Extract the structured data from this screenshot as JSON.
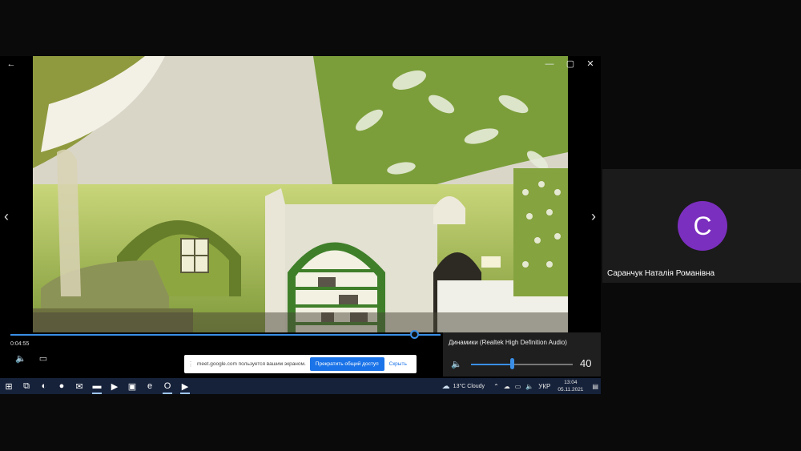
{
  "video": {
    "elapsed": "0:04:55"
  },
  "window_controls": {
    "back": "←",
    "minimize": "—",
    "maximize": "▢",
    "close": "✕"
  },
  "nav": {
    "prev": "‹",
    "next": "›"
  },
  "share_banner": {
    "message": "meet.google.com пользуется вашим экраном.",
    "stop_label": "Прекратить общий доступ",
    "hide_label": "Скрыть"
  },
  "volume": {
    "device": "Динамики (Realtek High Definition Audio)",
    "level": 40,
    "level_fraction": 0.4
  },
  "taskbar": {
    "apps": [
      {
        "icon": "windows-start-icon",
        "glyph": "⊞"
      },
      {
        "icon": "task-view-icon",
        "glyph": "⧉"
      },
      {
        "icon": "edge-icon",
        "glyph": "◐"
      },
      {
        "icon": "firefox-icon",
        "glyph": "●"
      },
      {
        "icon": "mail-icon",
        "glyph": "✉"
      },
      {
        "icon": "file-explorer-icon",
        "glyph": "▬"
      },
      {
        "icon": "media-player-icon",
        "glyph": "▶"
      },
      {
        "icon": "store-icon",
        "glyph": "▣"
      },
      {
        "icon": "internet-explorer-icon",
        "glyph": "e"
      },
      {
        "icon": "opera-icon",
        "glyph": "O"
      },
      {
        "icon": "movies-tv-icon",
        "glyph": "▶"
      }
    ],
    "weather_temp": "13°C",
    "weather_text": "Cloudy",
    "language": "УКР",
    "time": "13:04",
    "date": "05.11.2021"
  },
  "participant": {
    "initial": "C",
    "name": "Саранчук Наталія Романівна",
    "avatar_color": "#7b2fbf"
  },
  "colors": {
    "accent": "#3a8ee6",
    "taskbar": "#16223a"
  }
}
